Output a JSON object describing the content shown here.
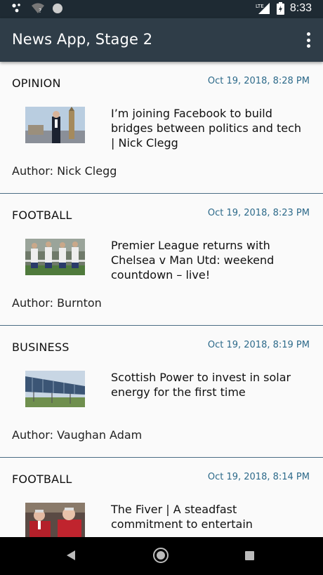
{
  "status_bar": {
    "time": "8:33",
    "network_label": "LTE",
    "icons": [
      "notification-icon",
      "wifi-icon",
      "sync-icon",
      "signal-icon",
      "battery-icon"
    ]
  },
  "app_bar": {
    "title": "News App, Stage 2",
    "menu_icon": "overflow-menu-icon"
  },
  "articles": [
    {
      "section": "OPINION",
      "date": "Oct 19, 2018,   8:28 PM",
      "headline": "I’m joining Facebook to build bridges between politics and tech | Nick Clegg",
      "author": "Author: Nick Clegg",
      "thumbnail": "man-in-suit-big-ben"
    },
    {
      "section": "FOOTBALL",
      "date": "Oct 19, 2018,   8:23 PM",
      "headline": "Premier League returns with Chelsea v Man Utd: weekend countdown – live!",
      "author": "Author: Burnton",
      "thumbnail": "players-in-stadium"
    },
    {
      "section": "BUSINESS",
      "date": "Oct 19, 2018,   8:19 PM",
      "headline": "Scottish Power to invest in solar energy for the first time",
      "author": "Author: Vaughan Adam",
      "thumbnail": "solar-panels-field"
    },
    {
      "section": "FOOTBALL",
      "date": "Oct 19, 2018,   8:14 PM",
      "headline": "The Fiver | A steadfast commitment to entertain",
      "author": "",
      "thumbnail": "managers-in-red"
    }
  ],
  "nav_bar": {
    "icons": [
      "back-icon",
      "home-icon",
      "recent-apps-icon"
    ]
  },
  "colors": {
    "status_bar": "#1e2a33",
    "app_bar": "#2f3d48",
    "divider": "#4a6d84",
    "date_text": "#2d6a8a",
    "background": "#fafafa"
  }
}
